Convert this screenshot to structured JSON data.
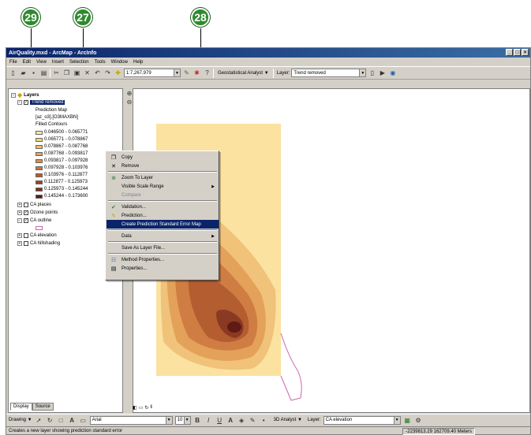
{
  "callouts": [
    "29",
    "27",
    "28"
  ],
  "window": {
    "title": "AirQuality.mxd - ArcMap - ArcInfo"
  },
  "menubar": [
    "File",
    "Edit",
    "View",
    "Insert",
    "Selection",
    "Tools",
    "Window",
    "Help"
  ],
  "toolbar": {
    "scale": "1:7,267,979",
    "geostat_label": "Geostatistical Analyst",
    "layer_label": "Layer:",
    "layer_value": "Trend removed"
  },
  "toc": {
    "root": "Layers",
    "selected_layer": "Trend removed",
    "subitems": [
      "Prediction Map",
      "[az_o3].[O3MAXBN]",
      "Filled Contours"
    ],
    "legend": [
      {
        "label": "0.046500 - 0.065771",
        "color": "#fde7a3"
      },
      {
        "label": "0.065771 - 0.078867",
        "color": "#f9d282"
      },
      {
        "label": "0.078867 - 0.087768",
        "color": "#f2bb6a"
      },
      {
        "label": "0.087768 - 0.093817",
        "color": "#e9a356"
      },
      {
        "label": "0.093817 - 0.097928",
        "color": "#dc8c47"
      },
      {
        "label": "0.097928 - 0.103976",
        "color": "#cc7339"
      },
      {
        "label": "0.103976 - 0.112877",
        "color": "#b65b2d"
      },
      {
        "label": "0.112877 - 0.125973",
        "color": "#9c4423"
      },
      {
        "label": "0.125973 - 0.145244",
        "color": "#7e2e1b"
      },
      {
        "label": "0.145244 - 0.173600",
        "color": "#5e1a13"
      }
    ],
    "layers": [
      "CA places",
      "Ozone points",
      "CA outline",
      "CA elevation",
      "CA hillshading"
    ],
    "tabs": [
      "Display",
      "Source"
    ]
  },
  "context_menu": [
    {
      "label": "Copy",
      "icon": "copy-icon"
    },
    {
      "label": "Remove",
      "icon": "remove-icon"
    },
    {
      "label": "Zoom To Layer",
      "icon": "zoom-to-layer-icon"
    },
    {
      "label": "Visible Scale Range",
      "submenu": true
    },
    {
      "label": "Compare",
      "disabled": true
    },
    {
      "label": "Validation...",
      "icon": "validation-icon"
    },
    {
      "label": "Prediction...",
      "icon": "prediction-icon"
    },
    {
      "label": "Create Prediction Standard Error Map",
      "highlighted": true
    },
    {
      "label": "Data",
      "submenu": true
    },
    {
      "label": "Save As Layer File..."
    },
    {
      "label": "Method Properties...",
      "icon": "method-properties-icon"
    },
    {
      "label": "Properties...",
      "icon": "properties-icon"
    }
  ],
  "drawbar": {
    "drawing": "Drawing",
    "font": "Arial",
    "size": "10",
    "analyst": "3D Analyst",
    "layer_label": "Layer:",
    "layer_value": "CA elevation"
  },
  "status": {
    "message": "Creates a new layer showing prediction standard error",
    "coords": "-2239813.29  162709.40 Meters"
  },
  "colors": {
    "title_bar": "#0a246a",
    "highlight": "#0a246a",
    "callout": "#2e8b2e",
    "outline": "#cc66aa"
  }
}
